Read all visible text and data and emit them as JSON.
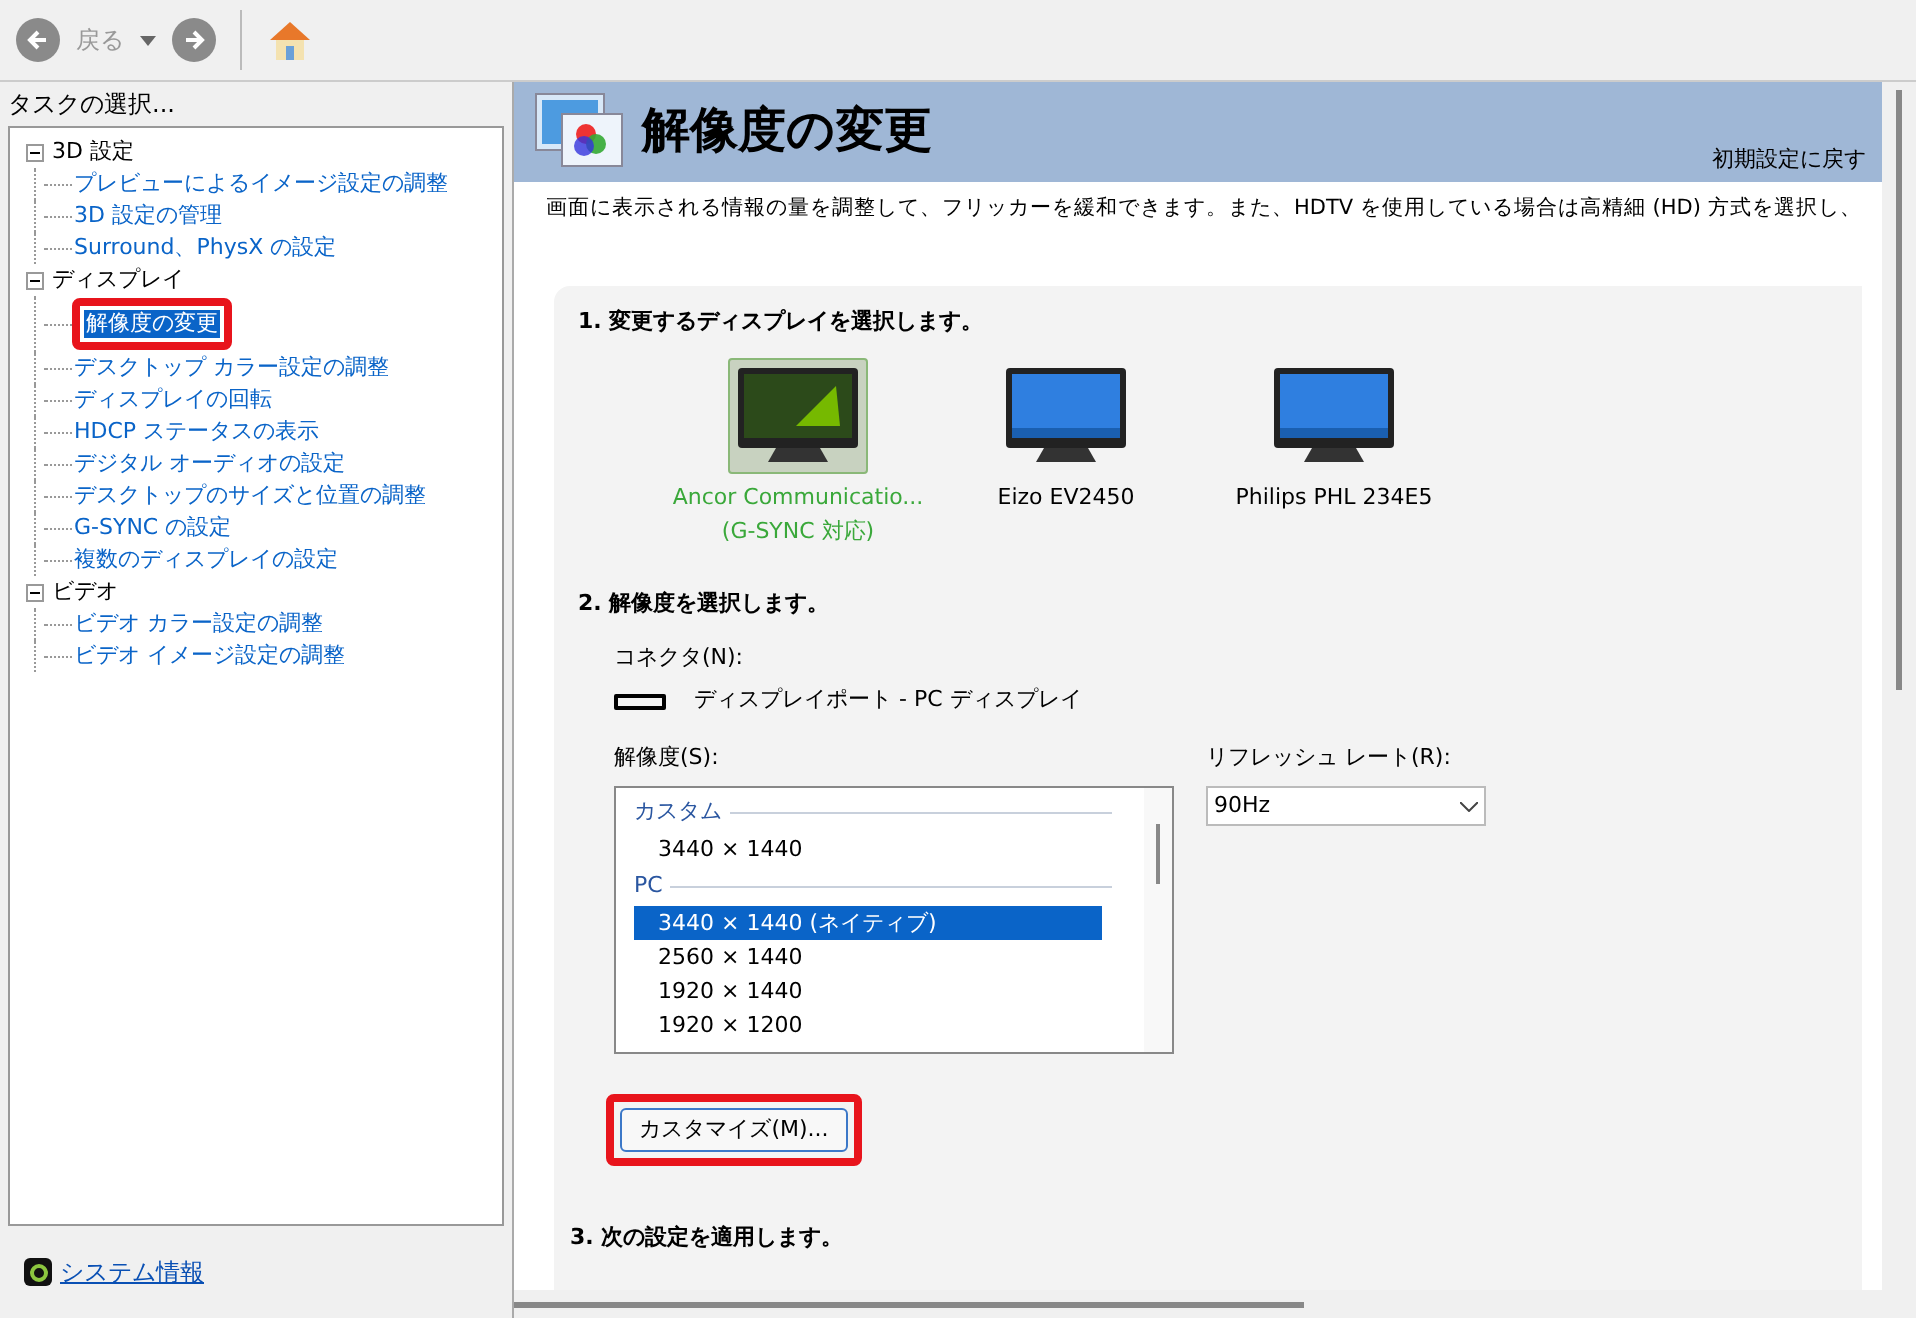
{
  "toolbar": {
    "back_label": "戻る"
  },
  "sidebar": {
    "header": "タスクの選択...",
    "tree": [
      {
        "label": "3D 設定",
        "expanded": true,
        "children": [
          {
            "label": "プレビューによるイメージ設定の調整",
            "selected": false,
            "annotated": false
          },
          {
            "label": "3D 設定の管理",
            "selected": false,
            "annotated": false
          },
          {
            "label": "Surround、PhysX の設定",
            "selected": false,
            "annotated": false
          }
        ]
      },
      {
        "label": "ディスプレイ",
        "expanded": true,
        "children": [
          {
            "label": "解像度の変更",
            "selected": true,
            "annotated": true
          },
          {
            "label": "デスクトップ カラー設定の調整",
            "selected": false,
            "annotated": false
          },
          {
            "label": "ディスプレイの回転",
            "selected": false,
            "annotated": false
          },
          {
            "label": "HDCP ステータスの表示",
            "selected": false,
            "annotated": false
          },
          {
            "label": "デジタル オーディオの設定",
            "selected": false,
            "annotated": false
          },
          {
            "label": "デスクトップのサイズと位置の調整",
            "selected": false,
            "annotated": false
          },
          {
            "label": "G-SYNC の設定",
            "selected": false,
            "annotated": false
          },
          {
            "label": "複数のディスプレイの設定",
            "selected": false,
            "annotated": false
          }
        ]
      },
      {
        "label": "ビデオ",
        "expanded": true,
        "children": [
          {
            "label": "ビデオ カラー設定の調整",
            "selected": false,
            "annotated": false
          },
          {
            "label": "ビデオ イメージ設定の調整",
            "selected": false,
            "annotated": false
          }
        ]
      }
    ],
    "footer_link": "システム情報"
  },
  "page": {
    "title": "解像度の変更",
    "restore_link": "初期設定に戻す",
    "description": "画面に表示される情報の量を調整して、フリッカーを緩和できます。また、HDTV を使用している場合は高精細 (HD) 方式を選択し、"
  },
  "section1": {
    "title": "1. 変更するディスプレイを選択します。",
    "displays": [
      {
        "name": "Ancor Communicatio...",
        "sub": "(G-SYNC 対応)",
        "kind": "gsync",
        "selected": true
      },
      {
        "name": "Eizo EV2450",
        "kind": "standard",
        "selected": false
      },
      {
        "name": "Philips PHL 234E5",
        "kind": "standard",
        "selected": false
      }
    ]
  },
  "section2": {
    "title": "2. 解像度を選択します。",
    "connector_label": "コネクタ(N):",
    "connector_value": "ディスプレイポート - PC ディスプレイ",
    "resolution_label": "解像度(S):",
    "refresh_label": "リフレッシュ レート(R):",
    "refresh_value": "90Hz",
    "resolution_groups": [
      {
        "label": "カスタム",
        "items": [
          {
            "label": "3440 × 1440",
            "selected": false
          }
        ]
      },
      {
        "label": "PC",
        "items": [
          {
            "label": "3440 × 1440 (ネイティブ)",
            "selected": true
          },
          {
            "label": "2560 × 1440",
            "selected": false
          },
          {
            "label": "1920 × 1440",
            "selected": false
          },
          {
            "label": "1920 × 1200",
            "selected": false
          }
        ]
      }
    ],
    "customize_button": {
      "label": "カスタマイズ(M)...",
      "annotated": true
    }
  },
  "section3": {
    "title": "3. 次の設定を適用します。"
  }
}
